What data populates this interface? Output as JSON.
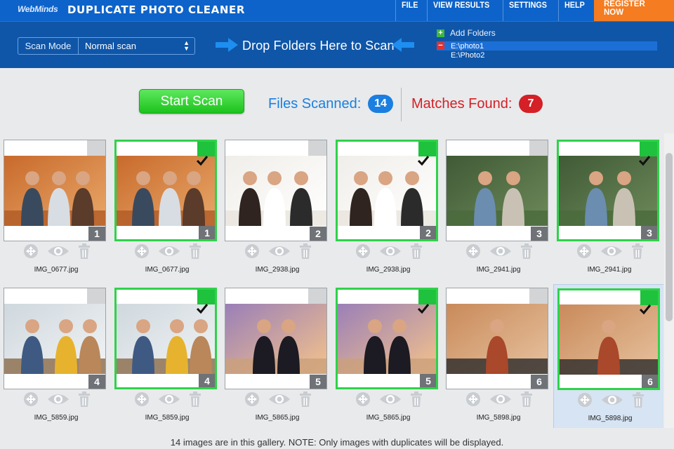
{
  "header": {
    "logo": "WebMinds",
    "title": "DUPLICATE PHOTO CLEANER",
    "menu": [
      "FILE",
      "VIEW RESULTS",
      "SETTINGS",
      "HELP",
      "REGISTER NOW"
    ]
  },
  "toolbar": {
    "scan_mode_label": "Scan Mode",
    "scan_mode_value": "Normal scan",
    "drop_text": "Drop Folders Here to Scan",
    "add_folders": "Add Folders",
    "folders": [
      "E:\\photo1",
      "E:\\Photo2"
    ]
  },
  "status": {
    "start_scan": "Start Scan",
    "files_scanned_label": "Files Scanned:",
    "files_scanned": "14",
    "matches_found_label": "Matches Found:",
    "matches_found": "7"
  },
  "gallery": {
    "items": [
      {
        "filename": "IMG_0677.jpg",
        "group": "1",
        "checked": false
      },
      {
        "filename": "IMG_0677.jpg",
        "group": "1",
        "checked": true
      },
      {
        "filename": "IMG_2938.jpg",
        "group": "2",
        "checked": false
      },
      {
        "filename": "IMG_2938.jpg",
        "group": "2",
        "checked": true
      },
      {
        "filename": "IMG_2941.jpg",
        "group": "3",
        "checked": false
      },
      {
        "filename": "IMG_2941.jpg",
        "group": "3",
        "checked": true
      },
      {
        "filename": "IMG_5859.jpg",
        "group": "4",
        "checked": false
      },
      {
        "filename": "IMG_5859.jpg",
        "group": "4",
        "checked": true
      },
      {
        "filename": "IMG_5865.jpg",
        "group": "5",
        "checked": false
      },
      {
        "filename": "IMG_5865.jpg",
        "group": "5",
        "checked": true
      },
      {
        "filename": "IMG_5898.jpg",
        "group": "6",
        "checked": false
      },
      {
        "filename": "IMG_5898.jpg",
        "group": "6",
        "checked": true
      }
    ]
  },
  "footer": {
    "note": "14 images are in this gallery. NOTE: Only images with duplicates will be displayed."
  },
  "colors": {
    "brand_blue": "#0d63c9",
    "toolbar_blue": "#0f56a8",
    "register_orange": "#f57c20",
    "start_green": "#1cc21c",
    "files_blue": "#1a7fe0",
    "matches_red": "#d42026",
    "checked_green": "#2fd24a"
  },
  "icons": {
    "add_folder": "plus-icon",
    "remove_folder": "minus-icon",
    "arrow": "arrow-icon",
    "tile_actions": [
      "move-icon",
      "preview-eye-icon",
      "trash-icon"
    ],
    "checkbox": "checkmark-icon"
  }
}
